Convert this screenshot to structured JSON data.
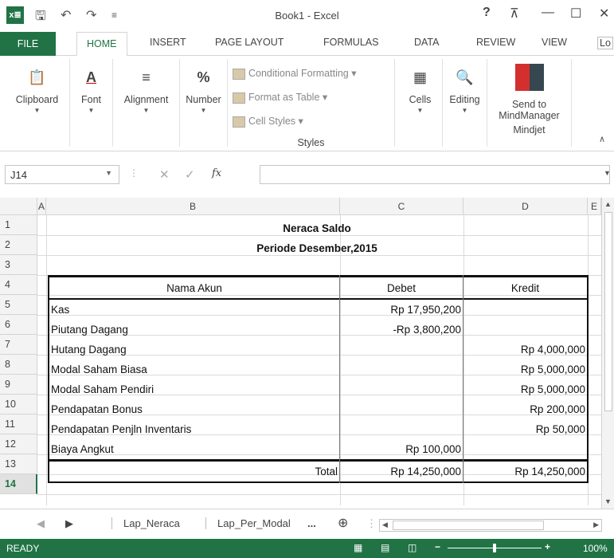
{
  "app": {
    "title": "Book1 - Excel",
    "icon_text": "x≣",
    "help": "?",
    "ribbon_toggle": "⊼",
    "minimize": "—",
    "maximize": "☐",
    "close": "✕"
  },
  "tabs": [
    "FILE",
    "HOME",
    "INSERT",
    "PAGE LAYOUT",
    "FORMULAS",
    "DATA",
    "REVIEW",
    "VIEW",
    "Lo"
  ],
  "ribbon": {
    "clipboard": "Clipboard",
    "font": "Font",
    "alignment": "Alignment",
    "number": "Number",
    "conditional_formatting": "Conditional Formatting",
    "format_as_table": "Format as Table",
    "cell_styles": "Cell Styles",
    "styles_group": "Styles",
    "cells": "Cells",
    "editing": "Editing",
    "send_to": "Send to",
    "mindmanager": "MindManager",
    "mindjet": "Mindjet"
  },
  "formula_bar": {
    "name_box": "J14",
    "fx": "fx",
    "value": ""
  },
  "columns": [
    "A",
    "B",
    "C",
    "D",
    "E"
  ],
  "rows": [
    "1",
    "2",
    "3",
    "4",
    "5",
    "6",
    "7",
    "8",
    "9",
    "10",
    "11",
    "12",
    "13",
    "14"
  ],
  "sheet": {
    "title": "Neraca Saldo",
    "period": "Periode Desember,2015",
    "headers": {
      "account": "Nama Akun",
      "debit": "Debet",
      "credit": "Kredit"
    },
    "entries": [
      {
        "account": "Kas",
        "debit": "Rp 17,950,200",
        "credit": ""
      },
      {
        "account": "Piutang Dagang",
        "debit": "-Rp 3,800,200",
        "credit": ""
      },
      {
        "account": "Hutang Dagang",
        "debit": "",
        "credit": "Rp 4,000,000"
      },
      {
        "account": "Modal Saham Biasa",
        "debit": "",
        "credit": "Rp 5,000,000"
      },
      {
        "account": "Modal Saham Pendiri",
        "debit": "",
        "credit": "Rp 5,000,000"
      },
      {
        "account": "Pendapatan Bonus",
        "debit": "",
        "credit": "Rp 200,000"
      },
      {
        "account": "Pendapatan Penjln Inventaris",
        "debit": "",
        "credit": "Rp 50,000"
      },
      {
        "account": "Biaya Angkut",
        "debit": "Rp 100,000",
        "credit": ""
      }
    ],
    "total": {
      "label": "Total",
      "debit": "Rp 14,250,000",
      "credit": "Rp 14,250,000"
    }
  },
  "sheet_tabs": {
    "tab1": "Lap_Neraca",
    "tab2": "Lap_Per_Modal",
    "more": "...",
    "add": "⊕"
  },
  "status": {
    "ready": "READY",
    "zoom": "100%"
  }
}
